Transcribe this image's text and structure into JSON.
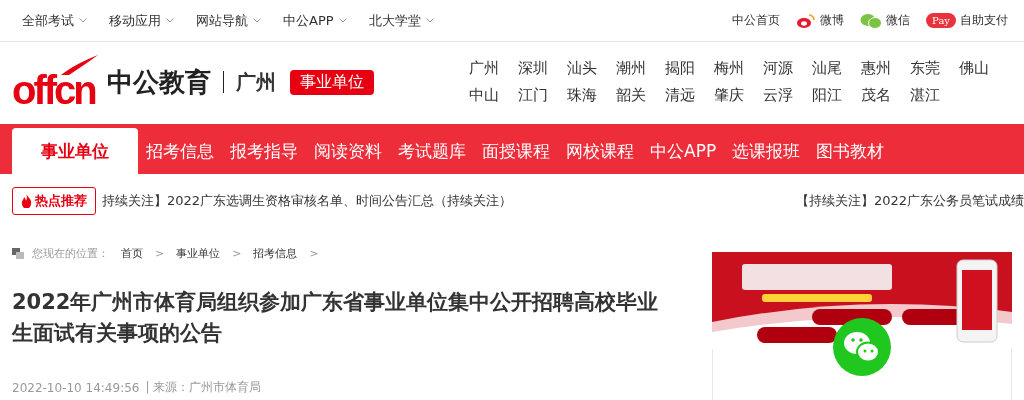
{
  "top_bar": {
    "menus": [
      "全部考试",
      "移动应用",
      "网站导航",
      "中公APP",
      "北大学堂"
    ],
    "links": [
      {
        "kind": "plain",
        "label": "中公首页"
      },
      {
        "kind": "weibo",
        "label": "微博"
      },
      {
        "kind": "wechat",
        "label": "微信"
      },
      {
        "kind": "pay",
        "badge": "Pay",
        "label": "自助支付"
      }
    ]
  },
  "header": {
    "logo_mark": "offcn",
    "logo_name": "中公教育",
    "city": "广州",
    "category": "事业单位",
    "cities": [
      "广州",
      "深圳",
      "汕头",
      "潮州",
      "揭阳",
      "梅州",
      "河源",
      "汕尾",
      "惠州",
      "东莞",
      "佛山",
      "中山",
      "江门",
      "珠海",
      "韶关",
      "清远",
      "肇庆",
      "云浮",
      "阳江",
      "茂名",
      "湛江"
    ]
  },
  "nav": [
    {
      "label": "事业单位",
      "selected": true
    },
    {
      "label": "招考信息",
      "selected": false
    },
    {
      "label": "报考指导",
      "selected": false
    },
    {
      "label": "阅读资料",
      "selected": false
    },
    {
      "label": "考试题库",
      "selected": false
    },
    {
      "label": "面授课程",
      "selected": false
    },
    {
      "label": "网校课程",
      "selected": false
    },
    {
      "label": "中公APP",
      "selected": false
    },
    {
      "label": "选课报班",
      "selected": false
    },
    {
      "label": "图书教材",
      "selected": false
    }
  ],
  "ticker": {
    "badge": "热点推荐",
    "items": [
      "持续关注】2022广东选调生资格审核名单、时间公告汇总（持续关注）",
      "【持续关注】2022广东公务员笔试成绩"
    ]
  },
  "breadcrumb": {
    "label": "您现在的位置：",
    "items": [
      "首页",
      "事业单位",
      "招考信息"
    ],
    "separator": ">"
  },
  "article": {
    "title": "2022年广州市体育局组织参加广东省事业单位集中公开招聘高校毕业生面试有关事项的公告",
    "date": "2022-10-10 14:49:56",
    "source": "| 来源：广州市体育局"
  }
}
